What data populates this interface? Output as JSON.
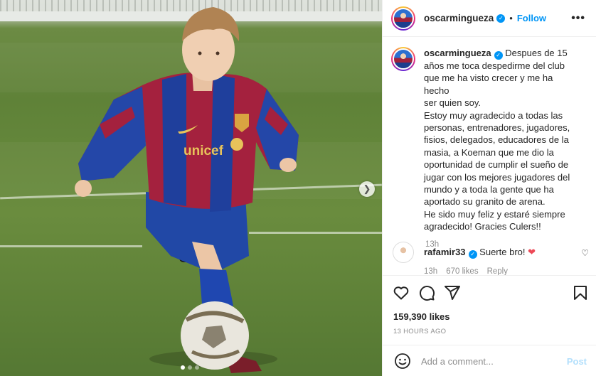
{
  "media": {
    "carousel_count": 3,
    "active_index": 0
  },
  "header": {
    "username": "oscarmingueza",
    "separator": "•",
    "follow": "Follow",
    "more": "•••"
  },
  "caption": {
    "username": "oscarmingueza",
    "lines": [
      "Despues de 15",
      "años me toca despedirme del club",
      "que me ha visto crecer y me ha hecho",
      "ser quien soy.",
      "Estoy muy agradecido a todas las",
      "personas, entrenadores, jugadores,",
      "fisios, delegados, educadores de la",
      "masia, a Koeman que me dio la",
      "oportunidad de cumplir el sueño de",
      "jugar con los mejores jugadores del",
      "mundo y a toda la gente que ha",
      "aportado su granito de arena.",
      "He sido muy feliz y estaré siempre",
      "agradecido! Gracies Culers!!"
    ],
    "time": "13h"
  },
  "comment": {
    "username": "rafamir33",
    "text": "Suerte bro!",
    "emoji": "❤",
    "time": "13h",
    "likes": "670 likes",
    "reply": "Reply"
  },
  "actions": {
    "likes": "159,390 likes",
    "ago": "13 HOURS AGO"
  },
  "add_comment": {
    "placeholder": "Add a comment...",
    "post": "Post"
  },
  "colors": {
    "accent": "#0095f6",
    "red": "#ed4956",
    "post_disabled": "#b2dffc"
  }
}
